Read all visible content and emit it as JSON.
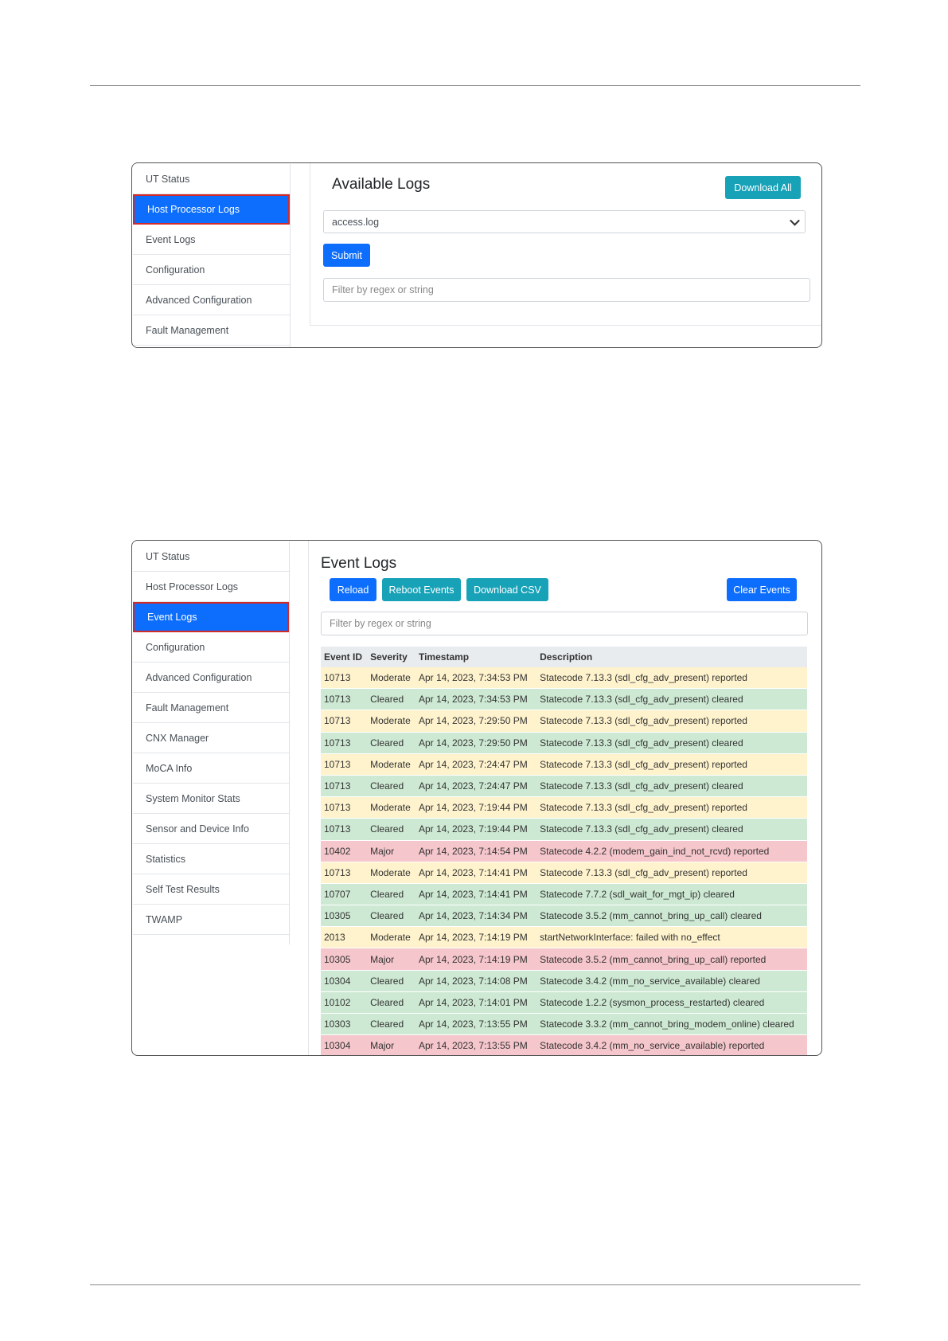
{
  "screenshot1": {
    "sidebar": [
      {
        "label": "UT Status",
        "active": false
      },
      {
        "label": "Host Processor Logs",
        "active": true
      },
      {
        "label": "Event Logs",
        "active": false
      },
      {
        "label": "Configuration",
        "active": false
      },
      {
        "label": "Advanced Configuration",
        "active": false
      },
      {
        "label": "Fault Management",
        "active": false
      }
    ],
    "title": "Available Logs",
    "download_all": "Download All",
    "log_select_value": "access.log",
    "submit": "Submit",
    "filter_placeholder": "Filter by regex or string"
  },
  "screenshot2": {
    "sidebar": [
      {
        "label": "UT Status",
        "active": false
      },
      {
        "label": "Host Processor Logs",
        "active": false
      },
      {
        "label": "Event Logs",
        "active": true
      },
      {
        "label": "Configuration",
        "active": false
      },
      {
        "label": "Advanced Configuration",
        "active": false
      },
      {
        "label": "Fault Management",
        "active": false
      },
      {
        "label": "CNX Manager",
        "active": false
      },
      {
        "label": "MoCA Info",
        "active": false
      },
      {
        "label": "System Monitor Stats",
        "active": false
      },
      {
        "label": "Sensor and Device Info",
        "active": false
      },
      {
        "label": "Statistics",
        "active": false
      },
      {
        "label": "Self Test Results",
        "active": false
      },
      {
        "label": "TWAMP",
        "active": false
      }
    ],
    "title": "Event Logs",
    "buttons": {
      "reload": "Reload",
      "reboot_events": "Reboot Events",
      "download_csv": "Download CSV",
      "clear_events": "Clear Events"
    },
    "filter_placeholder": "Filter by regex or string",
    "table": {
      "headers": [
        "Event ID",
        "Severity",
        "Timestamp",
        "Description"
      ],
      "rows": [
        {
          "id": "10713",
          "severity": "Moderate",
          "timestamp": "Apr 14, 2023, 7:34:53 PM",
          "description": "Statecode 7.13.3 (sdl_cfg_adv_present) reported"
        },
        {
          "id": "10713",
          "severity": "Cleared",
          "timestamp": "Apr 14, 2023, 7:34:53 PM",
          "description": "Statecode 7.13.3 (sdl_cfg_adv_present) cleared"
        },
        {
          "id": "10713",
          "severity": "Moderate",
          "timestamp": "Apr 14, 2023, 7:29:50 PM",
          "description": "Statecode 7.13.3 (sdl_cfg_adv_present) reported"
        },
        {
          "id": "10713",
          "severity": "Cleared",
          "timestamp": "Apr 14, 2023, 7:29:50 PM",
          "description": "Statecode 7.13.3 (sdl_cfg_adv_present) cleared"
        },
        {
          "id": "10713",
          "severity": "Moderate",
          "timestamp": "Apr 14, 2023, 7:24:47 PM",
          "description": "Statecode 7.13.3 (sdl_cfg_adv_present) reported"
        },
        {
          "id": "10713",
          "severity": "Cleared",
          "timestamp": "Apr 14, 2023, 7:24:47 PM",
          "description": "Statecode 7.13.3 (sdl_cfg_adv_present) cleared"
        },
        {
          "id": "10713",
          "severity": "Moderate",
          "timestamp": "Apr 14, 2023, 7:19:44 PM",
          "description": "Statecode 7.13.3 (sdl_cfg_adv_present) reported"
        },
        {
          "id": "10713",
          "severity": "Cleared",
          "timestamp": "Apr 14, 2023, 7:19:44 PM",
          "description": "Statecode 7.13.3 (sdl_cfg_adv_present) cleared"
        },
        {
          "id": "10402",
          "severity": "Major",
          "timestamp": "Apr 14, 2023, 7:14:54 PM",
          "description": "Statecode 4.2.2 (modem_gain_ind_not_rcvd) reported"
        },
        {
          "id": "10713",
          "severity": "Moderate",
          "timestamp": "Apr 14, 2023, 7:14:41 PM",
          "description": "Statecode 7.13.3 (sdl_cfg_adv_present) reported"
        },
        {
          "id": "10707",
          "severity": "Cleared",
          "timestamp": "Apr 14, 2023, 7:14:41 PM",
          "description": "Statecode 7.7.2 (sdl_wait_for_mgt_ip) cleared"
        },
        {
          "id": "10305",
          "severity": "Cleared",
          "timestamp": "Apr 14, 2023, 7:14:34 PM",
          "description": "Statecode 3.5.2 (mm_cannot_bring_up_call) cleared"
        },
        {
          "id": "2013",
          "severity": "Moderate",
          "timestamp": "Apr 14, 2023, 7:14:19 PM",
          "description": "startNetworkInterface: failed with no_effect"
        },
        {
          "id": "10305",
          "severity": "Major",
          "timestamp": "Apr 14, 2023, 7:14:19 PM",
          "description": "Statecode 3.5.2 (mm_cannot_bring_up_call) reported"
        },
        {
          "id": "10304",
          "severity": "Cleared",
          "timestamp": "Apr 14, 2023, 7:14:08 PM",
          "description": "Statecode 3.4.2 (mm_no_service_available) cleared"
        },
        {
          "id": "10102",
          "severity": "Cleared",
          "timestamp": "Apr 14, 2023, 7:14:01 PM",
          "description": "Statecode 1.2.2 (sysmon_process_restarted) cleared"
        },
        {
          "id": "10303",
          "severity": "Cleared",
          "timestamp": "Apr 14, 2023, 7:13:55 PM",
          "description": "Statecode 3.3.2 (mm_cannot_bring_modem_online) cleared"
        },
        {
          "id": "10304",
          "severity": "Major",
          "timestamp": "Apr 14, 2023, 7:13:55 PM",
          "description": "Statecode 3.4.2 (mm_no_service_available) reported"
        }
      ]
    }
  }
}
